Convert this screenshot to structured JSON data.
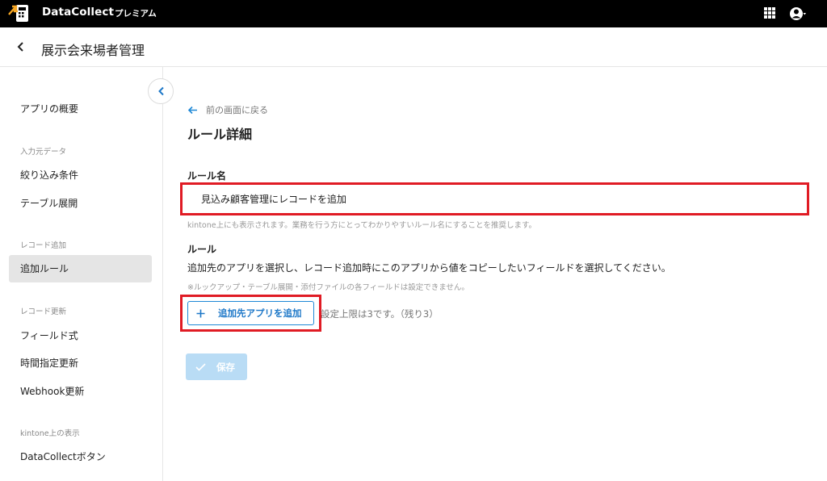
{
  "topbar": {
    "brand": "DataCollect",
    "plan": "プレミアム"
  },
  "header": {
    "app_title": "展示会来場者管理"
  },
  "sidebar": {
    "overview": "アプリの概要",
    "section_input": "入力元データ",
    "filter": "絞り込み条件",
    "table_expand": "テーブル展開",
    "section_add": "レコード追加",
    "add_rule": "追加ルール",
    "section_update": "レコード更新",
    "field_formula": "フィールド式",
    "scheduled_update": "時間指定更新",
    "webhook_update": "Webhook更新",
    "section_kintone": "kintone上の表示",
    "dc_button": "DataCollectボタン"
  },
  "main": {
    "back_link": "前の画面に戻る",
    "title": "ルール詳細",
    "rule_name_label": "ルール名",
    "rule_name_value": "見込み顧客管理にレコードを追加",
    "rule_name_help": "kintone上にも表示されます。業務を行う方にとってわかりやすいルール名にすることを推奨します。",
    "rule_label": "ルール",
    "rule_desc": "追加先のアプリを選択し、レコード追加時にこのアプリから値をコピーしたいフィールドを選択してください。",
    "rule_note": "※ルックアップ・テーブル展開・添付ファイルの各フィールドは設定できません。",
    "add_app_button": "追加先アプリを追加",
    "limit_text": "設定上限は3です。（残り3）",
    "save_button": "保存"
  },
  "colors": {
    "accent": "#1e88d6",
    "highlight": "#e01b24",
    "save_disabled": "#b9dcf5",
    "sidebar_active": "#e5e5e5"
  }
}
